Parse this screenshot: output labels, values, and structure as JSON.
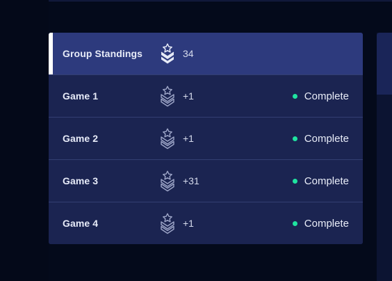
{
  "standings": {
    "header": {
      "label": "Group Standings",
      "points": "34"
    },
    "games": [
      {
        "label": "Game 1",
        "points": "+1",
        "status": "Complete"
      },
      {
        "label": "Game 2",
        "points": "+1",
        "status": "Complete"
      },
      {
        "label": "Game 3",
        "points": "+31",
        "status": "Complete"
      },
      {
        "label": "Game 4",
        "points": "+1",
        "status": "Complete"
      }
    ]
  },
  "icons": {
    "rank": "rank-chevron-star-icon",
    "status": "status-dot-icon"
  },
  "colors": {
    "background": "#040a1b",
    "panel": "#1b2451",
    "header_row": "#2d3a7d",
    "divider": "#333f72",
    "accent_bar": "#ffffff",
    "status_complete": "#1fe3a0",
    "text": "#e7ebf8"
  }
}
